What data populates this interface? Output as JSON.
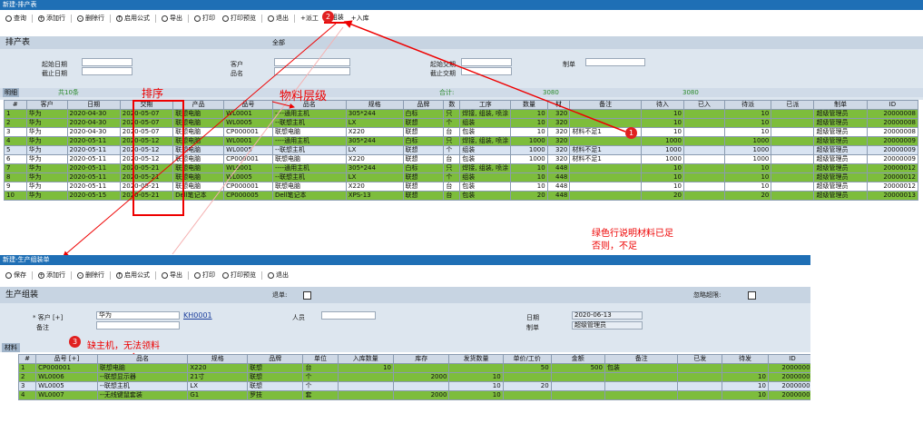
{
  "top": {
    "title": "新建-排产表",
    "toolbar": [
      "查询",
      "添加行",
      "删除行",
      "启用公式",
      "导出",
      "打印",
      "打印预览",
      "退出",
      "+派工",
      "+组装",
      "+入库"
    ],
    "panel_title": "排产表",
    "scope": "全部",
    "filters": {
      "start_date": "起始日期",
      "end_date": "截止日期",
      "customer": "客户",
      "product_name": "品名",
      "start_delivery": "起始交期",
      "end_delivery": "截止交期",
      "maker": "制单"
    },
    "subbar": {
      "tab": "明细",
      "count": "共10条",
      "total_label": "合计:",
      "total1": "3080",
      "total2": "3080"
    },
    "columns": [
      "#",
      "客户",
      "日期",
      "交期",
      "产品",
      "品号",
      "品名",
      "规格",
      "品牌",
      "数",
      "工序",
      "数量",
      "材",
      "备注",
      "待入",
      "已入",
      "待派",
      "已派",
      "制单",
      "ID"
    ],
    "rows": [
      [
        "1",
        "华为",
        "2020-04-30",
        "2020-05-07",
        "联想电脑",
        "WL0001",
        "----通用主机",
        "305*244",
        "白标",
        "只",
        "焊接, 组装, 喷涂",
        "10",
        "320",
        "",
        "10",
        "",
        "10",
        "",
        "超级管理员",
        "20000008"
      ],
      [
        "2",
        "华为",
        "2020-04-30",
        "2020-05-07",
        "联想电脑",
        "WL0005",
        "--联想主机",
        "LX",
        "联想",
        "个",
        "组装",
        "10",
        "320",
        "",
        "10",
        "",
        "10",
        "",
        "超级管理员",
        "20000008"
      ],
      [
        "3",
        "华为",
        "2020-04-30",
        "2020-05-07",
        "联想电脑",
        "CP000001",
        "联想电脑",
        "X220",
        "联想",
        "台",
        "包装",
        "10",
        "320",
        "材料不足1",
        "10",
        "",
        "10",
        "",
        "超级管理员",
        "20000008"
      ],
      [
        "4",
        "华为",
        "2020-05-11",
        "2020-05-12",
        "联想电脑",
        "WL0001",
        "----通用主机",
        "305*244",
        "白标",
        "只",
        "焊接, 组装, 喷涂",
        "1000",
        "320",
        "",
        "1000",
        "",
        "1000",
        "",
        "超级管理员",
        "20000009"
      ],
      [
        "5",
        "华为",
        "2020-05-11",
        "2020-05-12",
        "联想电脑",
        "WL0005",
        "--联想主机",
        "LX",
        "联想",
        "个",
        "组装",
        "1000",
        "320",
        "材料不足1",
        "1000",
        "",
        "1000",
        "",
        "超级管理员",
        "20000009"
      ],
      [
        "6",
        "华为",
        "2020-05-11",
        "2020-05-12",
        "联想电脑",
        "CP000001",
        "联想电脑",
        "X220",
        "联想",
        "台",
        "包装",
        "1000",
        "320",
        "材料不足1",
        "1000",
        "",
        "1000",
        "",
        "超级管理员",
        "20000009"
      ],
      [
        "7",
        "华为",
        "2020-05-11",
        "2020-05-21",
        "联想电脑",
        "WL0001",
        "----通用主机",
        "305*244",
        "白标",
        "只",
        "焊接, 组装, 喷涂",
        "10",
        "448",
        "",
        "10",
        "",
        "10",
        "",
        "超级管理员",
        "20000012"
      ],
      [
        "8",
        "华为",
        "2020-05-11",
        "2020-05-21",
        "联想电脑",
        "WL0005",
        "--联想主机",
        "LX",
        "联想",
        "个",
        "组装",
        "10",
        "448",
        "",
        "10",
        "",
        "10",
        "",
        "超级管理员",
        "20000012"
      ],
      [
        "9",
        "华为",
        "2020-05-11",
        "2020-05-21",
        "联想电脑",
        "CP000001",
        "联想电脑",
        "X220",
        "联想",
        "台",
        "包装",
        "10",
        "448",
        "",
        "10",
        "",
        "10",
        "",
        "超级管理员",
        "20000012"
      ],
      [
        "10",
        "华为",
        "2020-05-15",
        "2020-05-21",
        "Dell笔记本",
        "CP000005",
        "Dell笔记本",
        "XPS-13",
        "联想",
        "台",
        "包装",
        "20",
        "448",
        "",
        "20",
        "",
        "20",
        "",
        "超级管理员",
        "20000013"
      ]
    ],
    "row_styles": [
      "green",
      "green",
      "white",
      "green",
      "blue",
      "white",
      "green",
      "green",
      "white",
      "green"
    ]
  },
  "annotations": {
    "sort": "排序",
    "material_level": "物料层级",
    "green_note_1": "绿色行说明材料已足",
    "green_note_2": "否则，不足",
    "missing": "缺主机，无法领料",
    "n1": "1",
    "n2": "2",
    "n3": "3",
    "colors": {
      "red": "#e00000",
      "green": "#7dbd3c"
    }
  },
  "bottom": {
    "title": "新建-生产组装单",
    "toolbar": [
      "保存",
      "添加行",
      "删除行",
      "启用公式",
      "导出",
      "打印",
      "打印预览",
      "退出"
    ],
    "panel_title": "生产组装",
    "audit": "退单:",
    "force": "忽略超限:",
    "customer_label": "* 客户 [+]",
    "customer": "华为",
    "doc_no": "KH0001",
    "person": "人员",
    "remark": "备注",
    "date_label": "日期",
    "date": "2020-06-13",
    "maker_label": "制单",
    "maker": "超级管理员",
    "tab": "材料",
    "columns": [
      "#",
      "品号 [+]",
      "品名",
      "规格",
      "品牌",
      "单位",
      "入库数量",
      "库存",
      "发货数量",
      "单价/工价",
      "金额",
      "备注",
      "已发",
      "待发",
      "ID"
    ],
    "rows": [
      [
        "1",
        "CP000001",
        "联想电脑",
        "X220",
        "联想",
        "台",
        "10",
        "",
        "",
        "50",
        "500",
        "包装",
        "",
        "",
        "20000008"
      ],
      [
        "2",
        "WL0006",
        "--联想显示器",
        "21寸",
        "联想",
        "个",
        "",
        "2000",
        "10",
        "",
        "",
        "",
        "",
        "10",
        "20000008"
      ],
      [
        "3",
        "WL0005",
        "--联想主机",
        "LX",
        "联想",
        "个",
        "",
        "",
        "10",
        "20",
        "",
        "",
        "",
        "10",
        "20000008"
      ],
      [
        "4",
        "WL0007",
        "--无线键鼠套装",
        "G1",
        "罗技",
        "套",
        "",
        "2000",
        "10",
        "",
        "",
        "",
        "",
        "10",
        "20000008"
      ]
    ],
    "row_styles": [
      "green",
      "green",
      "blue",
      "green"
    ]
  }
}
